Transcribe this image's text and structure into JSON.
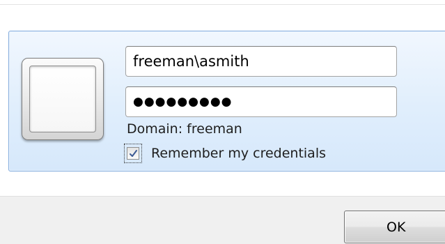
{
  "credentials": {
    "username_value": "freeman\\asmith",
    "password_masked": "●●●●●●●●●",
    "domain_text": "Domain: freeman",
    "remember_label": "Remember my credentials",
    "remember_checked": true
  },
  "dialog": {
    "ok_label": "OK"
  },
  "icons": {
    "user_tile": "user-picture-placeholder",
    "checkbox_mark": "checkmark-icon"
  },
  "colors": {
    "tile_border": "#84acdd",
    "tile_fill_top": "#f1f7fe",
    "tile_fill_bottom": "#d6e8fb",
    "check_mark": "#3c5a94"
  }
}
